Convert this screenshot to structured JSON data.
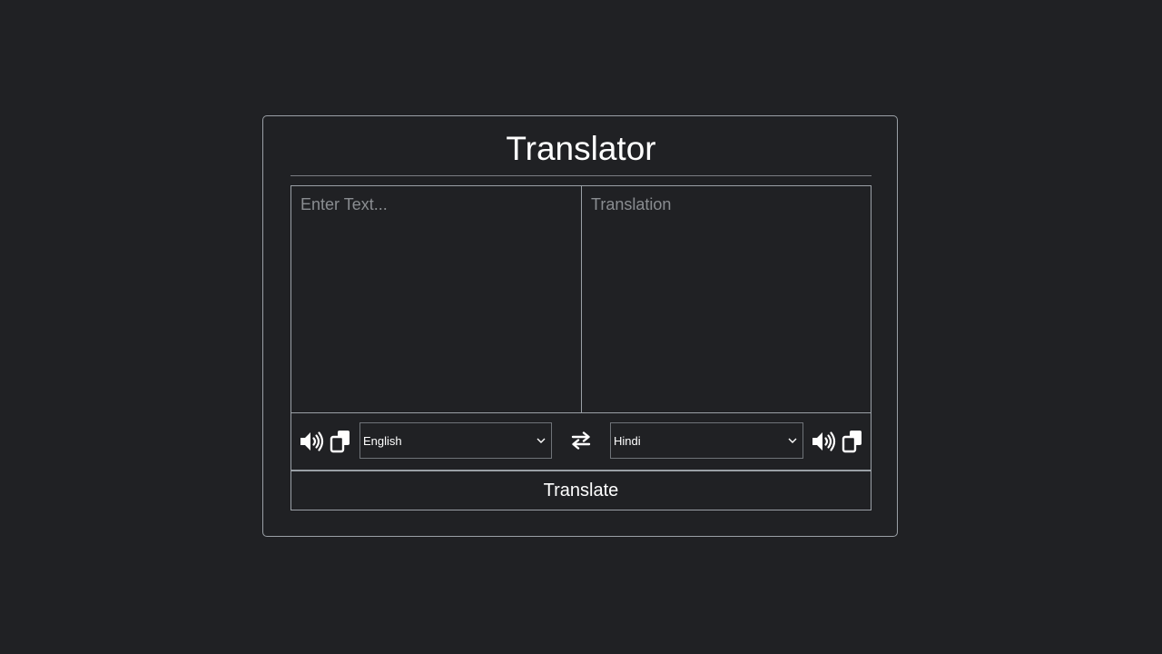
{
  "app": {
    "title": "Translator"
  },
  "input": {
    "placeholder": "Enter Text...",
    "value": ""
  },
  "output": {
    "placeholder": "Translation",
    "value": ""
  },
  "controls": {
    "from": {
      "selected_language": "English",
      "icons": [
        "volume-icon",
        "copy-icon"
      ]
    },
    "exchange_icon": "exchange-icon",
    "to": {
      "selected_language": "Hindi",
      "icons": [
        "volume-icon",
        "copy-icon"
      ]
    }
  },
  "translate_button": {
    "label": "Translate"
  },
  "colors": {
    "background": "#202124",
    "border": "#9aa0a6",
    "text": "#ffffff",
    "placeholder": "#8a8d91"
  }
}
